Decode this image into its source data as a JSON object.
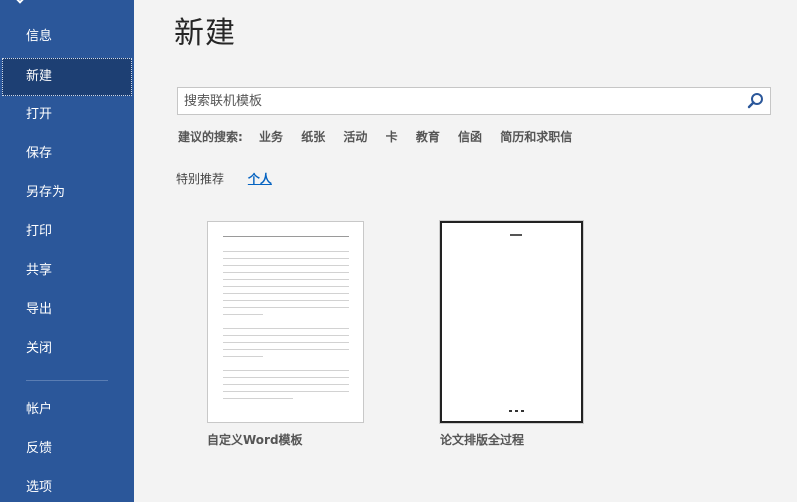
{
  "sidebar": {
    "items": [
      {
        "label": "信息"
      },
      {
        "label": "新建"
      },
      {
        "label": "打开"
      },
      {
        "label": "保存"
      },
      {
        "label": "另存为"
      },
      {
        "label": "打印"
      },
      {
        "label": "共享"
      },
      {
        "label": "导出"
      },
      {
        "label": "关闭"
      },
      {
        "label": "帐户"
      },
      {
        "label": "反馈"
      },
      {
        "label": "选项"
      }
    ],
    "active_item": "新建",
    "background_color": "#2b579a",
    "active_color": "#1d3f73"
  },
  "main": {
    "title": "新建",
    "search": {
      "placeholder": "搜索联机模板",
      "value": "",
      "icon": "search-icon"
    },
    "suggested": {
      "label": "建议的搜索:",
      "items": [
        "业务",
        "纸张",
        "活动",
        "卡",
        "教育",
        "信函",
        "简历和求职信"
      ]
    },
    "tabs": [
      {
        "label": "特别推荐"
      },
      {
        "label": "个人"
      }
    ],
    "selected_tab": "个人",
    "templates": [
      {
        "name": "自定义Word模板"
      },
      {
        "name": "论文排版全过程"
      }
    ],
    "link_color": "#0563c1"
  }
}
